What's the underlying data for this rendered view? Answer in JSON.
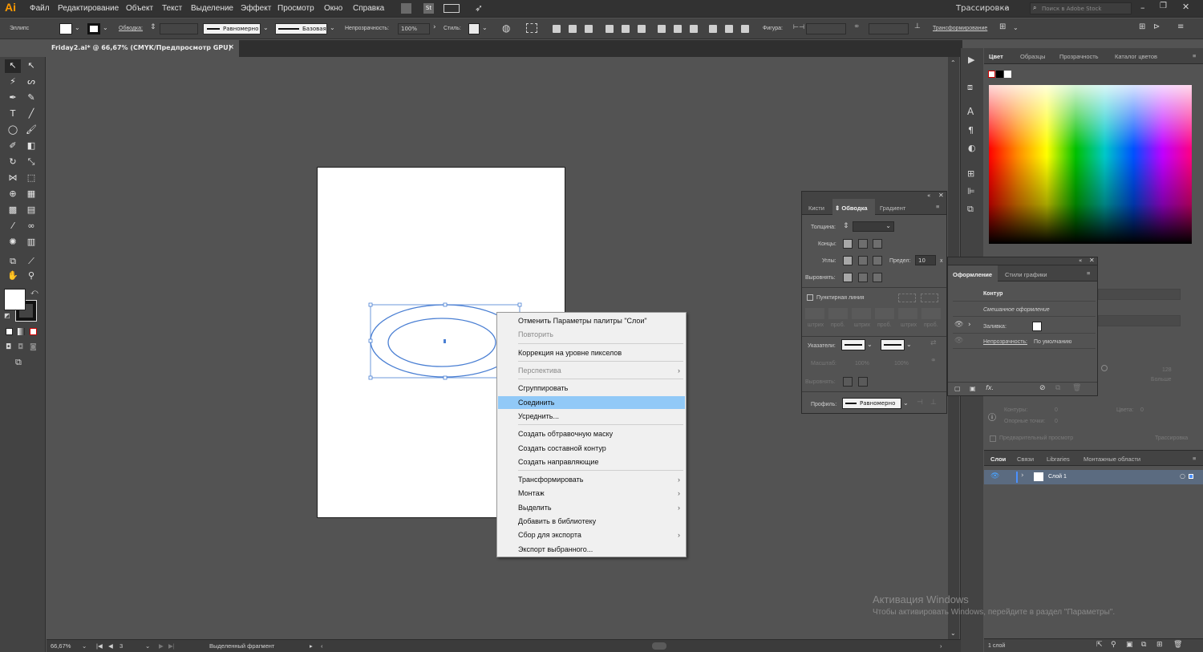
{
  "app": {
    "logo": "Ai"
  },
  "menubar": {
    "items": [
      "Файл",
      "Редактирование",
      "Объект",
      "Текст",
      "Выделение",
      "Эффект",
      "Просмотр",
      "Окно",
      "Справка"
    ],
    "bridge_label": "St",
    "workspace": "Трассировка",
    "search_placeholder": "Поиск в Adobe Stock"
  },
  "control": {
    "object_type": "Эллипс",
    "stroke_label": "Обводка:",
    "profile_label": "Равномерно",
    "brush_label": "Базовая",
    "opacity_label": "Непрозрачность:",
    "opacity_value": "100%",
    "style_label": "Стиль:",
    "shape_label": "Фигура:",
    "transform_label": "Трансформирование"
  },
  "document": {
    "tab_title": "Friday2.ai* @ 66,67% (CMYK/Предпросмотр GPU)",
    "close": "×"
  },
  "context_menu": {
    "items": [
      {
        "label": "Отменить Параметры палитры \"Слои\"",
        "state": "normal"
      },
      {
        "label": "Повторить",
        "state": "disabled"
      },
      {
        "label": "Коррекция на уровне пикселов",
        "state": "normal"
      },
      {
        "label": "Перспектива",
        "state": "disabled",
        "submenu": true
      },
      {
        "label": "Сгруппировать",
        "state": "normal"
      },
      {
        "label": "Соединить",
        "state": "highlighted"
      },
      {
        "label": "Усреднить...",
        "state": "normal"
      },
      {
        "label": "Создать обтравочную маску",
        "state": "normal"
      },
      {
        "label": "Создать составной контур",
        "state": "normal"
      },
      {
        "label": "Создать направляющие",
        "state": "normal"
      },
      {
        "label": "Трансформировать",
        "state": "normal",
        "submenu": true
      },
      {
        "label": "Монтаж",
        "state": "normal",
        "submenu": true
      },
      {
        "label": "Выделить",
        "state": "normal",
        "submenu": true
      },
      {
        "label": "Добавить в библиотеку",
        "state": "normal"
      },
      {
        "label": "Сбор для экспорта",
        "state": "normal",
        "submenu": true
      },
      {
        "label": "Экспорт выбранного...",
        "state": "normal"
      }
    ],
    "submenu_arrow": "›"
  },
  "color_panel": {
    "tabs": [
      "Цвет",
      "Образцы",
      "Прозрачность",
      "Каталог цветов"
    ]
  },
  "stroke_panel": {
    "tabs": [
      "Кисти",
      "Обводка",
      "Градиент"
    ],
    "weight_label": "Толщина:",
    "caps_label": "Концы:",
    "corners_label": "Углы:",
    "limit_label": "Предел:",
    "limit_value": "10",
    "limit_unit": "x",
    "align_label": "Выровнять:",
    "dashed_label": "Пунктирная линия",
    "dash_fields": [
      "штрих",
      "проб.",
      "штрих",
      "проб.",
      "штрих",
      "проб."
    ],
    "arrow_label": "Указатели:",
    "scale_label": "Масштаб:",
    "scale_values": [
      "100%",
      "100%"
    ],
    "align2_label": "Выровнять:",
    "profile_label": "Профиль:",
    "profile_value": "Равномерно"
  },
  "appearance_panel": {
    "tabs": [
      "Оформление",
      "Стили графики"
    ],
    "title": "Контур",
    "mixed": "Смешанное оформление",
    "fill_label": "Заливка:",
    "opacity_label": "Непрозрачность:",
    "opacity_value": "По умолчанию",
    "fx": "fx."
  },
  "trace_panel": {
    "contours_label": "Контуры:",
    "contours_value": "0",
    "colors_label": "Цвета:",
    "colors_value": "0",
    "anchors_label": "Опорные точки:",
    "anchors_value": "0",
    "preview_label": "Предварительный просмотр",
    "trace_button": "Трассировка",
    "more_label": "Больше",
    "threshold_value": "128"
  },
  "layers_panel": {
    "tabs": [
      "Слои",
      "Связи",
      "Libraries",
      "Монтажные области"
    ],
    "layer_name": "Слой 1",
    "count_label": "1 слой"
  },
  "status": {
    "zoom": "66,67%",
    "page": "3",
    "tool": "Выделенный фрагмент"
  },
  "watermark": {
    "title": "Активация Windows",
    "text": "Чтобы активировать Windows, перейдите в раздел \"Параметры\"."
  },
  "colors": {
    "accent": "#4a90d9",
    "highlight": "#91c9f7",
    "app_bg": "#535353"
  }
}
